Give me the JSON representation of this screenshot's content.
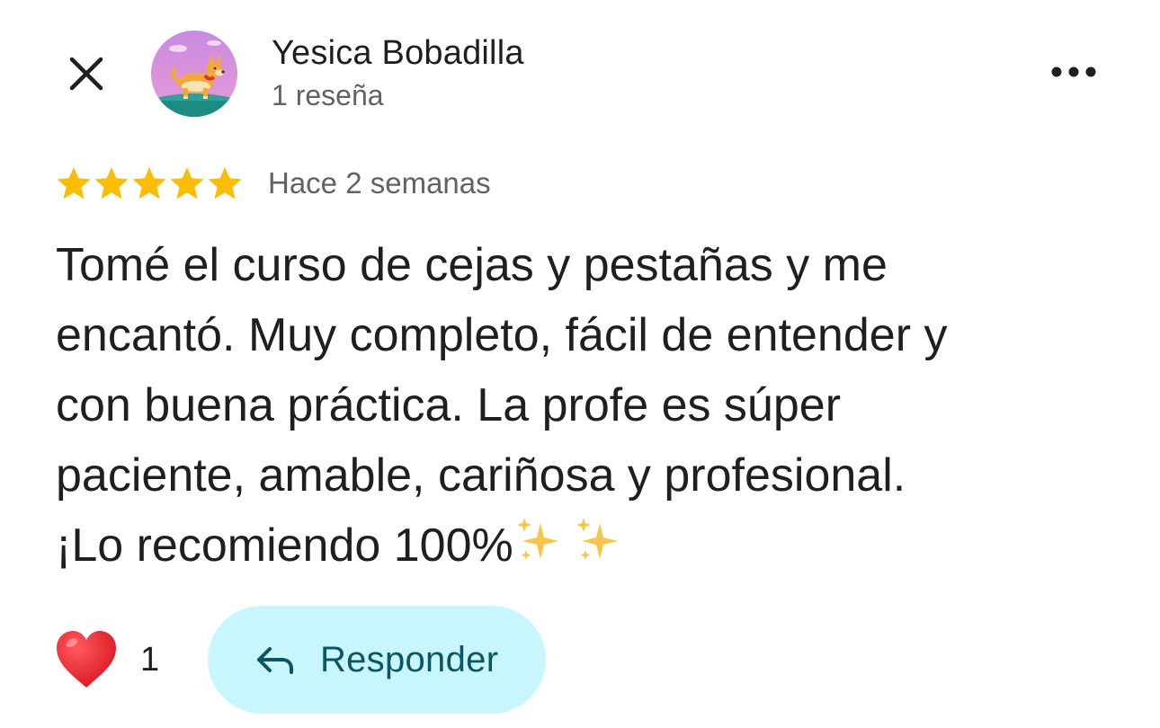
{
  "header": {
    "author_name": "Yesica Bobadilla",
    "review_count": "1 reseña"
  },
  "icons": {
    "close": "close-icon",
    "more": "more-horizontal-icon",
    "avatar": "corgi-avatar",
    "star": "star-icon",
    "heart": "heart-icon",
    "reply": "reply-arrow-icon"
  },
  "rating": {
    "stars": 5,
    "max": 5,
    "time_ago": "Hace 2 semanas"
  },
  "review": {
    "text": "Tomé el curso de cejas y pestañas y me\nencantó. Muy completo, fácil de entender y\ncon buena práctica. La profe es súper\npaciente, amable, cariñosa y profesional.\n¡Lo recomiendo 100%"
  },
  "actions": {
    "like_count": "1",
    "reply_label": "Responder"
  },
  "colors": {
    "star": "#FBBC04",
    "reply_bg": "#C9F6FD",
    "reply_text": "#0B5567",
    "heart": "#E0202A",
    "secondary_text": "#5F6368"
  }
}
